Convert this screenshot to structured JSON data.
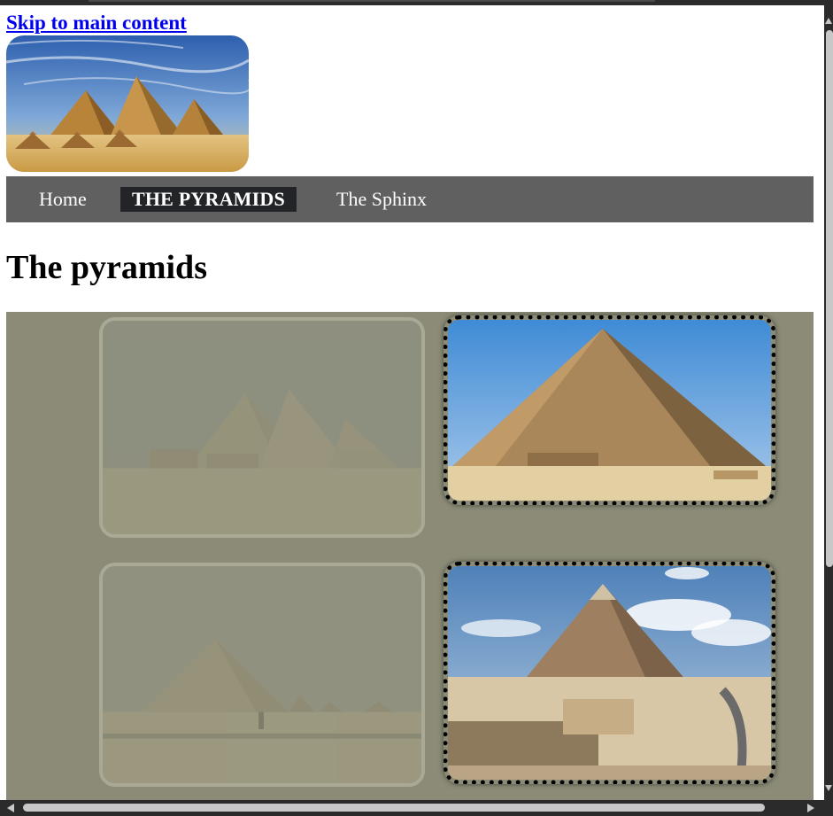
{
  "skip_link": "Skip to main content",
  "nav": {
    "items": [
      {
        "label": "Home",
        "active": false
      },
      {
        "label": "THE PYRAMIDS",
        "active": true
      },
      {
        "label": "The Sphinx",
        "active": false
      }
    ]
  },
  "main": {
    "title": "The pyramids"
  },
  "gallery": {
    "cards": [
      {
        "state": "faded"
      },
      {
        "state": "selected"
      },
      {
        "state": "faded"
      },
      {
        "state": "selected"
      }
    ]
  },
  "colors": {
    "nav_bg": "#606060",
    "nav_active_bg": "#222428",
    "gallery_bg": "#8b8b77",
    "link": "#0000ee"
  }
}
